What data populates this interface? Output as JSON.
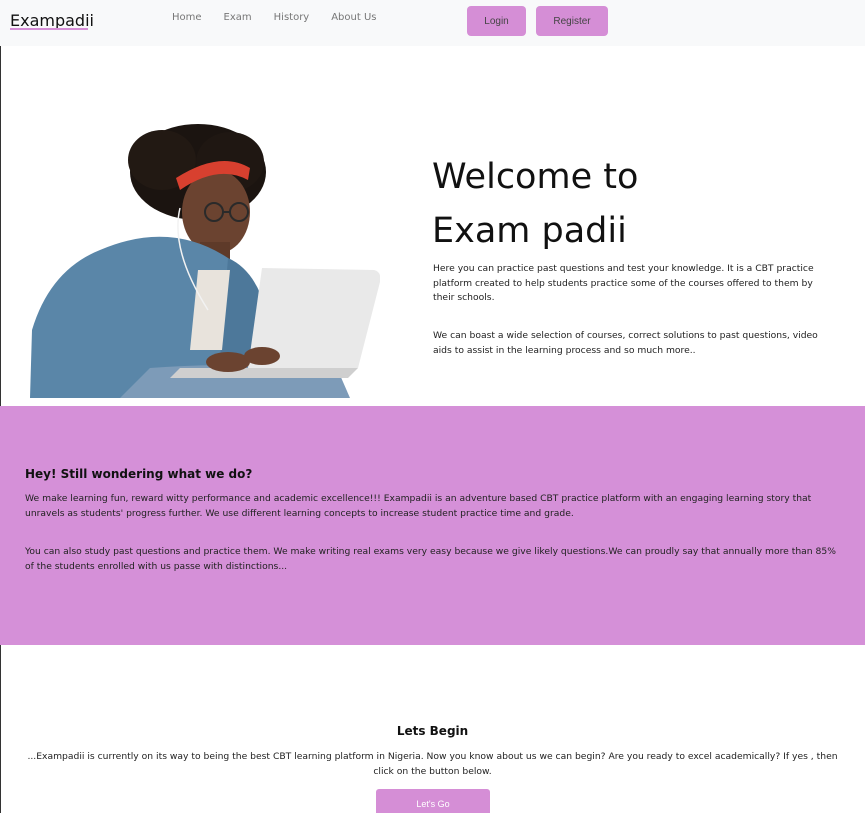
{
  "navbar": {
    "brand": "Exampadii",
    "links": [
      "Home",
      "Exam",
      "History",
      "About Us"
    ],
    "login_label": "Login",
    "register_label": "Register"
  },
  "hero": {
    "title_line1": "Welcome to",
    "title_line2": "Exam padii",
    "paragraph1": "Here you can practice past questions and test your knowledge. It is a CBT practice platform created to help students practice some of the courses offered to them by their schools.",
    "paragraph2": "We can boast a wide selection of courses, correct solutions to past questions, video aids to assist in the learning process and so much more.."
  },
  "about": {
    "heading": "Hey! Still wondering what we do?",
    "paragraph1": "We make learning fun, reward witty performance and academic excellence!!! Exampadii is an adventure based CBT practice platform with an engaging learning story that unravels as students' progress further. We use different learning concepts to increase student practice time and grade.",
    "paragraph2": "You can also study past questions and practice them. We make writing real exams very easy because we give likely questions.We can proudly say that annually more than 85% of the students enrolled with us passe with distinctions..."
  },
  "begin": {
    "heading": "Lets Begin",
    "paragraph": "...Exampadii is currently on its way to being the best CBT learning platform in Nigeria. Now you know about us we can begin? Are you ready to excel academically? If yes , then click on the button below.",
    "button_label": "Let's Go"
  },
  "colors": {
    "accent": "#d58ed6",
    "section_bg": "#d590d8",
    "navbar_bg": "#f8f9fa"
  }
}
